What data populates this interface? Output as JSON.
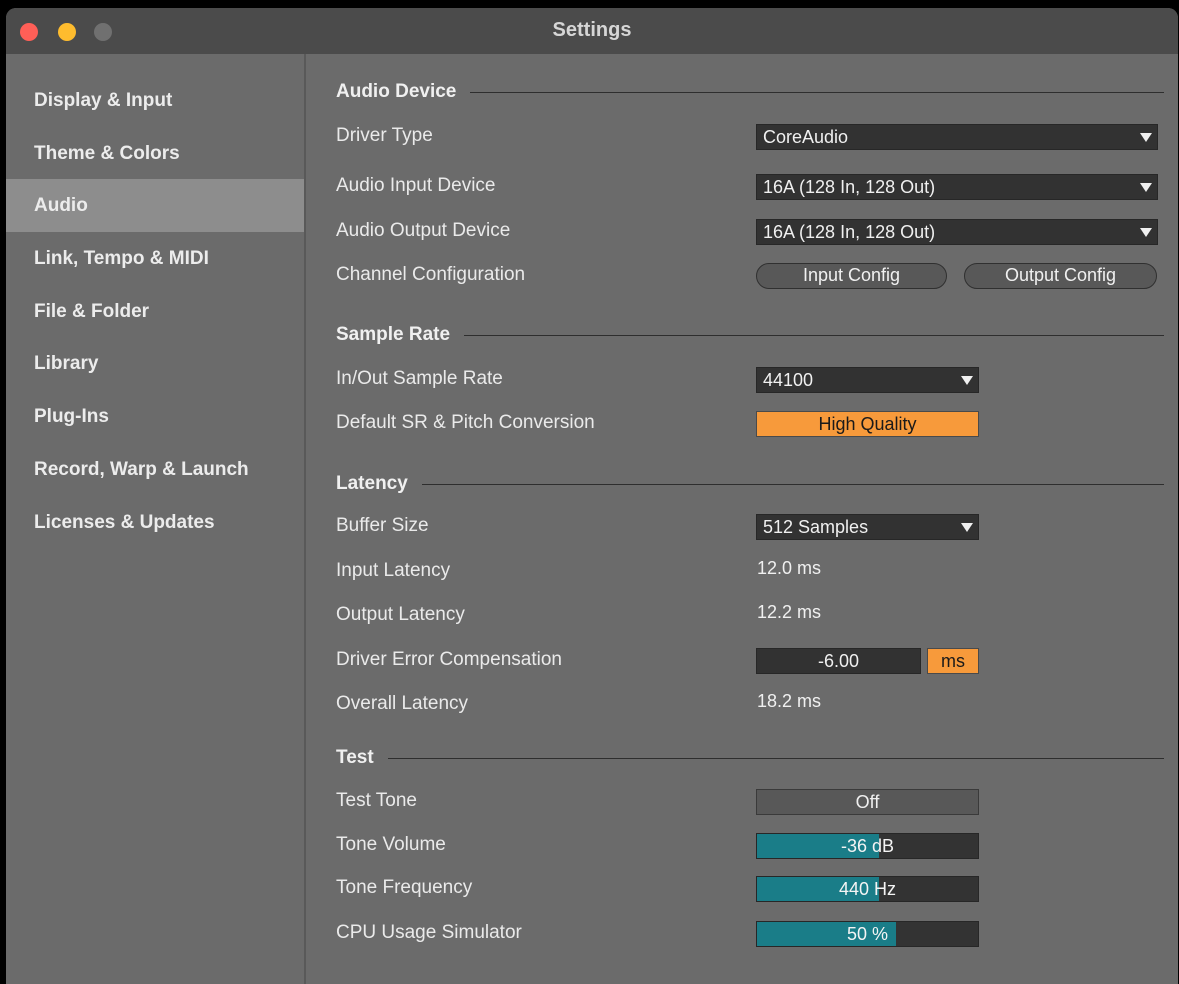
{
  "window": {
    "title": "Settings",
    "traffic_colors": {
      "close": "#ff5f57",
      "minimize": "#febc2e",
      "zoom": "#707070"
    }
  },
  "sidebar": {
    "items": [
      {
        "label": "Display & Input",
        "selected": false
      },
      {
        "label": "Theme & Colors",
        "selected": false
      },
      {
        "label": "Audio",
        "selected": true
      },
      {
        "label": "Link, Tempo & MIDI",
        "selected": false
      },
      {
        "label": "File & Folder",
        "selected": false
      },
      {
        "label": "Library",
        "selected": false
      },
      {
        "label": "Plug-Ins",
        "selected": false
      },
      {
        "label": "Record, Warp & Launch",
        "selected": false
      },
      {
        "label": "Licenses & Updates",
        "selected": false
      }
    ]
  },
  "audio_device": {
    "section_title": "Audio Device",
    "driver_type": {
      "label": "Driver Type",
      "value": "CoreAudio"
    },
    "input_device": {
      "label": "Audio Input Device",
      "value": "16A (128 In, 128 Out)"
    },
    "output_device": {
      "label": "Audio Output Device",
      "value": "16A (128 In, 128 Out)"
    },
    "channel_config": {
      "label": "Channel Configuration",
      "input_button": "Input Config",
      "output_button": "Output Config"
    }
  },
  "sample_rate": {
    "section_title": "Sample Rate",
    "in_out": {
      "label": "In/Out Sample Rate",
      "value": "44100"
    },
    "conversion": {
      "label": "Default SR & Pitch Conversion",
      "value": "High Quality"
    }
  },
  "latency": {
    "section_title": "Latency",
    "buffer_size": {
      "label": "Buffer Size",
      "value": "512 Samples"
    },
    "input_latency": {
      "label": "Input Latency",
      "value": "12.0 ms"
    },
    "output_latency": {
      "label": "Output Latency",
      "value": "12.2 ms"
    },
    "driver_error": {
      "label": "Driver Error Compensation",
      "value": "-6.00",
      "unit": "ms"
    },
    "overall_latency": {
      "label": "Overall Latency",
      "value": "18.2 ms"
    }
  },
  "test": {
    "section_title": "Test",
    "test_tone": {
      "label": "Test Tone",
      "value": "Off"
    },
    "tone_volume": {
      "label": "Tone Volume",
      "value": "-36 dB",
      "fill": 0.55
    },
    "tone_frequency": {
      "label": "Tone Frequency",
      "value": "440 Hz",
      "fill": 0.55
    },
    "cpu_usage": {
      "label": "CPU Usage Simulator",
      "value": "50 %",
      "fill": 0.63
    }
  },
  "colors": {
    "accent_orange": "#f79a3b",
    "slider_fill": "#1a7d88",
    "selected_item": "#8d8d8d"
  }
}
